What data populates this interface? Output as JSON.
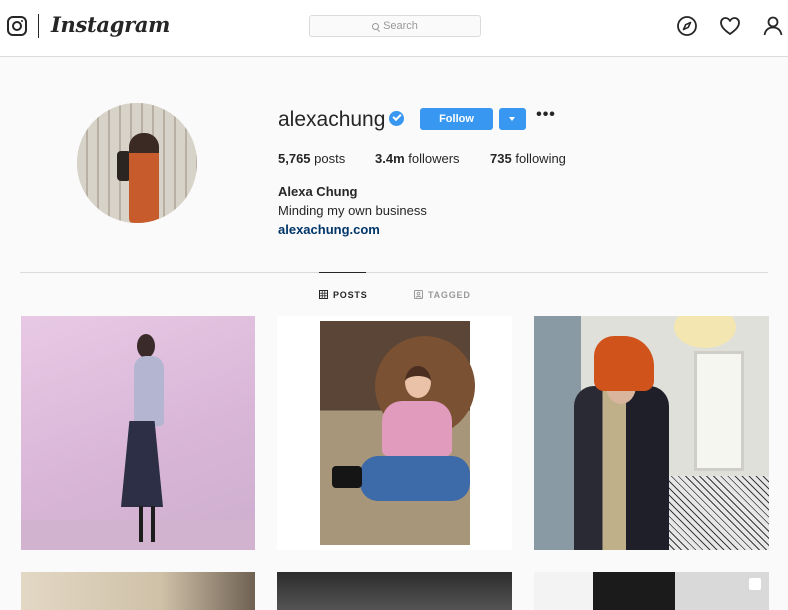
{
  "nav": {
    "brand": "Instagram",
    "search_placeholder": "Search"
  },
  "profile": {
    "username": "alexachung",
    "follow_label": "Follow",
    "more_label": "•••",
    "stats": {
      "posts_count": "5,765",
      "posts_label": "posts",
      "followers_count": "3.4m",
      "followers_label": "followers",
      "following_count": "735",
      "following_label": "following"
    },
    "full_name": "Alexa Chung",
    "bio": "Minding my own business",
    "website": "alexachung.com"
  },
  "tabs": [
    {
      "label": "POSTS",
      "active": true
    },
    {
      "label": "TAGGED",
      "active": false
    }
  ],
  "colors": {
    "follow_blue": "#3897f0",
    "link_blue": "#003569",
    "verified_blue": "#3897f0"
  }
}
